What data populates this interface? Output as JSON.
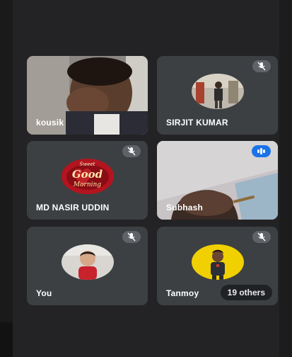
{
  "participants": [
    {
      "name": "kousik",
      "muted": false,
      "video": true
    },
    {
      "name": "SIRJIT KUMAR",
      "muted": true,
      "video": false
    },
    {
      "name": "MD NASIR UDDIN",
      "muted": true,
      "video": false
    },
    {
      "name": "Subhash",
      "muted": false,
      "speaking": true,
      "video": true
    },
    {
      "name": "You",
      "muted": true,
      "video": false
    },
    {
      "name": "Tanmoy",
      "muted": true,
      "video": false
    }
  ],
  "overflow": {
    "label": "19 others"
  },
  "avatar_art": {
    "line1": "Sweet",
    "line2": "Good",
    "line3": "Morning"
  },
  "icons": {
    "mute": "mic-off-icon",
    "speaking": "audio-level-icon"
  },
  "colors": {
    "background": "#232325",
    "tile": "#3c4043",
    "speaking_accent": "#1a73e8"
  }
}
